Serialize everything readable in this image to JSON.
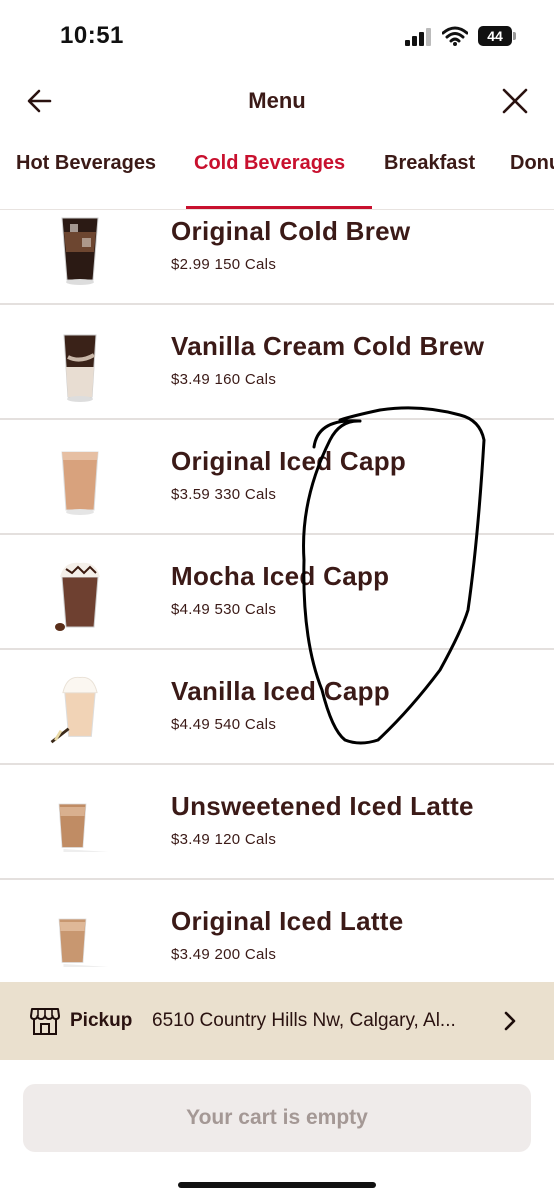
{
  "status_bar": {
    "time": "10:51",
    "battery": "44",
    "icons": [
      "signal-icon",
      "wifi-icon",
      "battery-icon"
    ]
  },
  "header": {
    "title": "Menu",
    "back_icon": "arrow-left-icon",
    "close_icon": "close-icon"
  },
  "tabs": [
    {
      "label": "Hot Beverages",
      "active": false
    },
    {
      "label": "Cold Beverages",
      "active": true
    },
    {
      "label": "Breakfast",
      "active": false
    },
    {
      "label": "Donu",
      "active": false
    }
  ],
  "menu_items": [
    {
      "name": "Original Cold Brew",
      "price": "$2.99",
      "calories": "150 Cals"
    },
    {
      "name": "Vanilla Cream Cold Brew",
      "price": "$3.49",
      "calories": "160 Cals"
    },
    {
      "name": "Original Iced Capp",
      "price": "$3.59",
      "calories": "330 Cals"
    },
    {
      "name": "Mocha Iced Capp",
      "price": "$4.49",
      "calories": "530 Cals"
    },
    {
      "name": "Vanilla Iced Capp",
      "price": "$4.49",
      "calories": "540 Cals"
    },
    {
      "name": "Unsweetened Iced Latte",
      "price": "$3.49",
      "calories": "120 Cals"
    },
    {
      "name": "Original Iced Latte",
      "price": "$3.49",
      "calories": "200 Cals"
    }
  ],
  "pickup": {
    "label": "Pickup",
    "address": "6510 Country Hills Nw, Calgary, Al...",
    "icon": "store-icon",
    "chevron_icon": "chevron-right-icon"
  },
  "cart": {
    "label": "Your cart is empty"
  },
  "colors": {
    "brand_red": "#c8102e",
    "text_brown": "#3b1a17",
    "pickup_bg": "#eae0ce",
    "cart_bg": "#efebea"
  }
}
